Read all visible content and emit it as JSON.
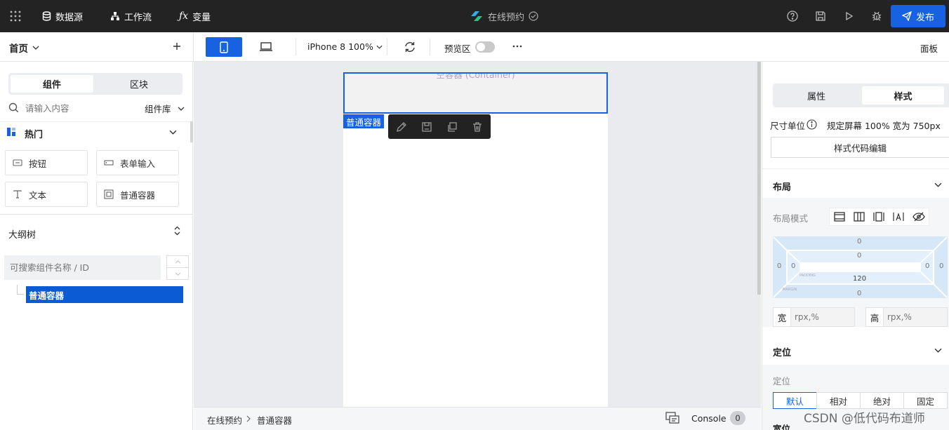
{
  "topbar": {
    "datasource": "数据源",
    "workflow": "工作流",
    "variables": "变量",
    "app_title": "在线预约",
    "publish": "发布"
  },
  "toolbar": {
    "page_name": "首页",
    "device_label": "iPhone 8 100%",
    "preview_label": "预览区",
    "panel_label": "面板"
  },
  "left": {
    "tabs": [
      "组件",
      "区块"
    ],
    "search_placeholder": "请输入内容",
    "library_label": "组件库",
    "hot_label": "热门",
    "components": [
      "按钮",
      "表单输入",
      "文本",
      "普通容器"
    ],
    "outline_title": "大纲树",
    "outline_search_placeholder": "可搜索组件名称 / ID",
    "tree_item": "普通容器"
  },
  "canvas": {
    "container_hint": "空容器 (Container)",
    "selected_tag": "普通容器"
  },
  "statusbar": {
    "breadcrumb": [
      "在线预约",
      "普通容器"
    ],
    "console_label": "Console",
    "console_count": "0"
  },
  "right": {
    "tabs": [
      "属性",
      "样式"
    ],
    "unit_label": "尺寸单位",
    "unit_value": "规定屏幕 100% 宽为 750px",
    "code_edit_button": "样式代码编辑",
    "layout_section": "布局",
    "layout_mode_label": "布局模式",
    "box_values": {
      "margin_top": "0",
      "padding_top": "0",
      "margin_left": "0",
      "padding_left": "0",
      "padding_right": "0",
      "margin_right": "0",
      "content": "120",
      "margin_bottom": "0"
    },
    "box_labels": {
      "padding": "PADDING",
      "margin": "MARGIN"
    },
    "width_label": "宽",
    "height_label": "高",
    "size_placeholder": "rpx,%",
    "position_section": "定位",
    "position_label": "定位",
    "position_options": [
      "默认",
      "相对",
      "绝对",
      "固定"
    ],
    "bottom_partial": "宽位"
  },
  "watermark": "CSDN @低代码布道师"
}
